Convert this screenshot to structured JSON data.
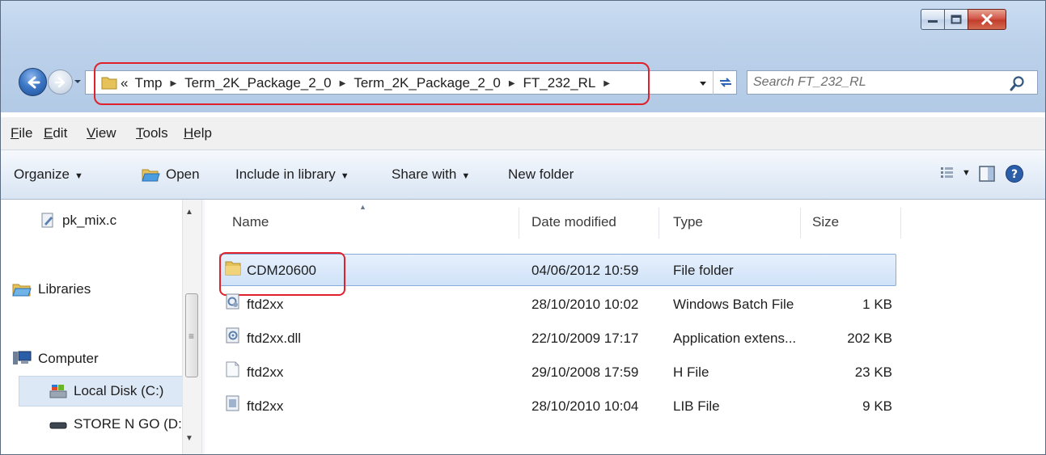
{
  "window": {
    "caption_buttons": [
      "minimize",
      "maximize",
      "close"
    ]
  },
  "address": {
    "overflow": "«",
    "segments": [
      "Tmp",
      "Term_2K_Package_2_0",
      "Term_2K_Package_2_0",
      "FT_232_RL"
    ]
  },
  "search": {
    "placeholder": "Search FT_232_RL"
  },
  "menu": {
    "items": [
      {
        "label": "File",
        "access": "F",
        "rest": "ile"
      },
      {
        "label": "Edit",
        "access": "E",
        "rest": "dit"
      },
      {
        "label": "View",
        "access": "V",
        "rest": "iew"
      },
      {
        "label": "Tools",
        "access": "T",
        "rest": "ools"
      },
      {
        "label": "Help",
        "access": "H",
        "rest": "elp"
      }
    ]
  },
  "toolbar": {
    "organize": "Organize",
    "open": "Open",
    "include": "Include in library",
    "share": "Share with",
    "new_folder": "New folder"
  },
  "nav": {
    "items": [
      "pk_mix.c",
      "Libraries",
      "Computer",
      "Local Disk (C:)",
      "STORE N GO (D:)"
    ]
  },
  "columns": [
    "Name",
    "Date modified",
    "Type",
    "Size"
  ],
  "files": [
    {
      "name": "CDM20600",
      "date": "04/06/2012 10:59",
      "type": "File folder",
      "size": "",
      "icon": "folder-icon"
    },
    {
      "name": "ftd2xx",
      "date": "28/10/2010 10:02",
      "type": "Windows Batch File",
      "size": "1 KB",
      "icon": "batch-file-icon"
    },
    {
      "name": "ftd2xx.dll",
      "date": "22/10/2009 17:17",
      "type": "Application extens...",
      "size": "202 KB",
      "icon": "dll-file-icon"
    },
    {
      "name": "ftd2xx",
      "date": "29/10/2008 17:59",
      "type": "H File",
      "size": "23 KB",
      "icon": "h-file-icon"
    },
    {
      "name": "ftd2xx",
      "date": "28/10/2010 10:04",
      "type": "LIB File",
      "size": "9 KB",
      "icon": "lib-file-icon"
    }
  ],
  "colors": {
    "highlight": "#e0202a",
    "selection": "#cfe2f8",
    "frame": "#bcd1ea"
  }
}
